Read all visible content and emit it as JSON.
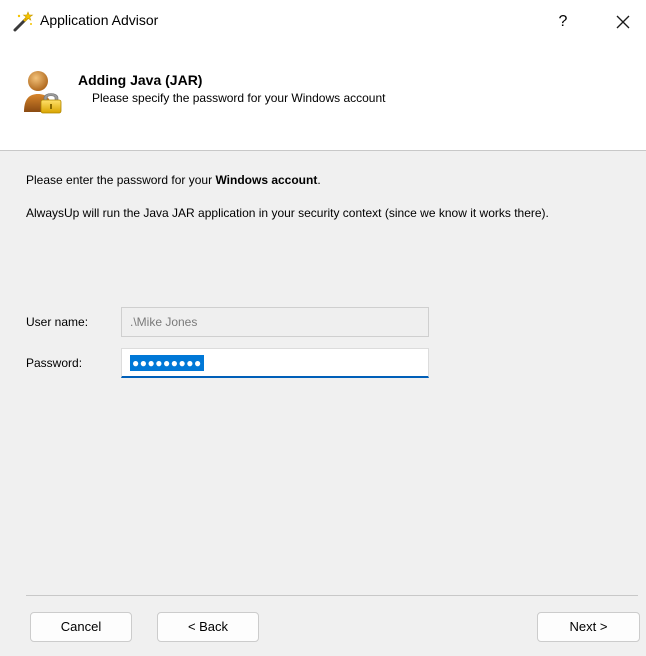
{
  "window": {
    "title": "Application Advisor",
    "help_label": "?",
    "close_label": "✕"
  },
  "header": {
    "title": "Adding Java (JAR)",
    "subtitle": "Please specify the password for your Windows account"
  },
  "content": {
    "intro_prefix": "Please enter the password for your ",
    "intro_bold": "Windows account",
    "intro_suffix": ".",
    "description": "AlwaysUp will run the Java JAR application in your security context (since we know it works there)."
  },
  "form": {
    "username_label": "User name:",
    "username_value": ".\\Mike Jones",
    "password_label": "Password:",
    "password_masked": "●●●●●●●●●"
  },
  "buttons": {
    "cancel": "Cancel",
    "back": "< Back",
    "next": "Next >"
  }
}
